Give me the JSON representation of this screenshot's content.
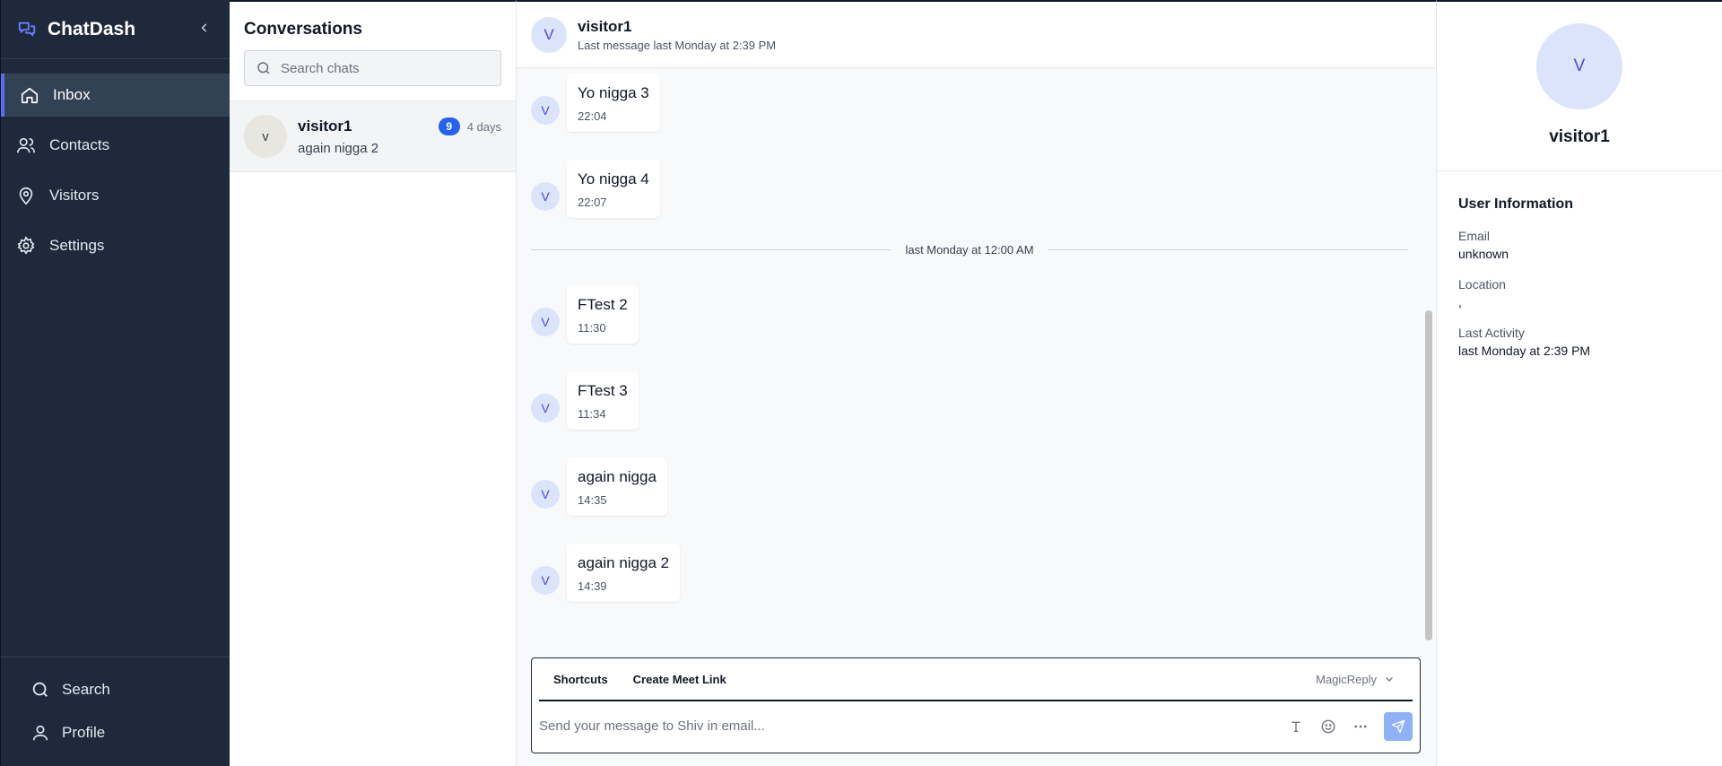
{
  "app": {
    "name": "ChatDash"
  },
  "sidebar": {
    "items": [
      {
        "label": "Inbox",
        "icon": "home-icon",
        "active": true
      },
      {
        "label": "Contacts",
        "icon": "users-icon"
      },
      {
        "label": "Visitors",
        "icon": "map-pin-icon"
      },
      {
        "label": "Settings",
        "icon": "gear-icon"
      }
    ],
    "bottom": [
      {
        "label": "Search",
        "icon": "search-icon"
      },
      {
        "label": "Profile",
        "icon": "user-icon"
      }
    ]
  },
  "conversations": {
    "title": "Conversations",
    "search_placeholder": "Search chats",
    "items": [
      {
        "avatar": "v",
        "name": "visitor1",
        "preview": "again nigga 2",
        "unread": "9",
        "time": "4 days"
      }
    ]
  },
  "chat": {
    "header": {
      "avatar": "V",
      "name": "visitor1",
      "subtitle": "Last message last Monday at 2:39 PM"
    },
    "divider": "last Monday at 12:00 AM",
    "messages": [
      {
        "avatar": "V",
        "text": "Yo nigga 3",
        "time": "22:04"
      },
      {
        "avatar": "V",
        "text": "Yo nigga 4",
        "time": "22:07"
      },
      {
        "avatar": "V",
        "text": "FTest 2",
        "time": "11:30"
      },
      {
        "avatar": "V",
        "text": "FTest 3",
        "time": "11:34"
      },
      {
        "avatar": "V",
        "text": "again nigga",
        "time": "14:35"
      },
      {
        "avatar": "V",
        "text": "again nigga 2",
        "time": "14:39"
      }
    ],
    "composer": {
      "tabs": [
        "Shortcuts",
        "Create Meet Link"
      ],
      "magic_reply": "MagicReply",
      "placeholder": "Send your message to Shiv in email..."
    }
  },
  "info": {
    "avatar": "V",
    "name": "visitor1",
    "section_title": "User Information",
    "fields": [
      {
        "label": "Email",
        "value": "unknown"
      },
      {
        "label": "Location",
        "value": ","
      },
      {
        "label": "Last Activity",
        "value": "last Monday at 2:39 PM"
      }
    ]
  },
  "colors": {
    "sidebar_bg": "#1e293b",
    "accent": "#5b6cf0",
    "badge": "#2563eb",
    "avatar_bg": "#dbe4fb",
    "send_button": "#8db2f7"
  }
}
